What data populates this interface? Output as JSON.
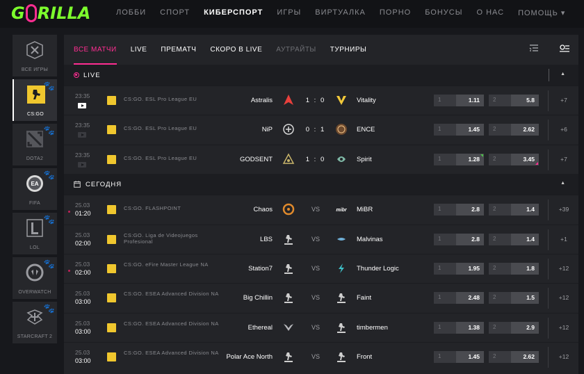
{
  "brand": {
    "logo_pre": "G",
    "logo_post": "RILLA",
    "accent": "#ff2e92",
    "logo_color": "#7dff2d"
  },
  "nav": [
    "ЛОББИ",
    "СПОРТ",
    "КИБЕРСПОРТ",
    "ИГРЫ",
    "ВИРТУАЛКА",
    "ПОРНО",
    "БОНУСЫ",
    "О НАС",
    "ПОМОЩЬ ▾"
  ],
  "sidebar": [
    {
      "label": "ВСЕ ИГРЫ",
      "icon": "all-games-icon"
    },
    {
      "label": "CS:GO",
      "icon": "csgo-icon"
    },
    {
      "label": "DOTA2",
      "icon": "dota2-icon"
    },
    {
      "label": "FIFA",
      "icon": "fifa-icon"
    },
    {
      "label": "LOL",
      "icon": "lol-icon"
    },
    {
      "label": "OVERWATCH",
      "icon": "overwatch-icon"
    },
    {
      "label": "STARCRAFT 2",
      "icon": "starcraft-icon"
    }
  ],
  "tabs": [
    "ВСЕ МАТЧИ",
    "LIVE",
    "ПРЕМАТЧ",
    "СКОРО В LIVE",
    "АУТРАЙТЫ",
    "ТУРНИРЫ"
  ],
  "sections": {
    "live": "LIVE",
    "today": "СЕГОДНЯ"
  },
  "live_matches": [
    {
      "time": "23:35",
      "league": "CS:GO. ESL Pro League EU",
      "team1": "Astralis",
      "score": "1 : 0",
      "team2": "Vitality",
      "odd1_label": "1",
      "odd1": "1.11",
      "odd2_label": "2",
      "odd2": "5.8",
      "more": "+7"
    },
    {
      "time": "23:35",
      "league": "CS:GO. ESL Pro League EU",
      "team1": "NiP",
      "score": "0 : 1",
      "team2": "ENCE",
      "odd1_label": "1",
      "odd1": "1.45",
      "odd2_label": "2",
      "odd2": "2.62",
      "more": "+6"
    },
    {
      "time": "23:35",
      "league": "CS:GO. ESL Pro League EU",
      "team1": "GODSENT",
      "score": "1 : 0",
      "team2": "Spirit",
      "odd1_label": "1",
      "odd1": "1.28",
      "odd2_label": "2",
      "odd2": "3.45",
      "more": "+7"
    }
  ],
  "today_matches": [
    {
      "date": "25.03",
      "time": "01:20",
      "league": "CS:GO. FLASHPOINT",
      "team1": "Chaos",
      "vs": "VS",
      "team2": "MiBR",
      "odd1_label": "1",
      "odd1": "2.8",
      "odd2_label": "2",
      "odd2": "1.4",
      "more": "+39"
    },
    {
      "date": "25.03",
      "time": "02:00",
      "league": "CS:GO. Liga de Videojuegos Profesional",
      "team1": "LBS",
      "vs": "VS",
      "team2": "Malvinas",
      "odd1_label": "1",
      "odd1": "2.8",
      "odd2_label": "2",
      "odd2": "1.4",
      "more": "+1"
    },
    {
      "date": "25.03",
      "time": "02:00",
      "league": "CS:GO. eFire Master League NA",
      "team1": "Station7",
      "vs": "VS",
      "team2": "Thunder Logic",
      "odd1_label": "1",
      "odd1": "1.95",
      "odd2_label": "2",
      "odd2": "1.8",
      "more": "+12"
    },
    {
      "date": "25.03",
      "time": "03:00",
      "league": "CS:GO. ESEA Advanced Division NA",
      "team1": "Big Chillin",
      "vs": "VS",
      "team2": "Faint",
      "odd1_label": "1",
      "odd1": "2.48",
      "odd2_label": "2",
      "odd2": "1.5",
      "more": "+12"
    },
    {
      "date": "25.03",
      "time": "03:00",
      "league": "CS:GO. ESEA Advanced Division NA",
      "team1": "Ethereal",
      "vs": "VS",
      "team2": "timbermen",
      "odd1_label": "1",
      "odd1": "1.38",
      "odd2_label": "2",
      "odd2": "2.9",
      "more": "+12"
    },
    {
      "date": "25.03",
      "time": "03:00",
      "league": "CS:GO. ESEA Advanced Division NA",
      "team1": "Polar Ace North",
      "vs": "VS",
      "team2": "Front",
      "odd1_label": "1",
      "odd1": "1.45",
      "odd2_label": "2",
      "odd2": "2.62",
      "more": "+12"
    }
  ]
}
